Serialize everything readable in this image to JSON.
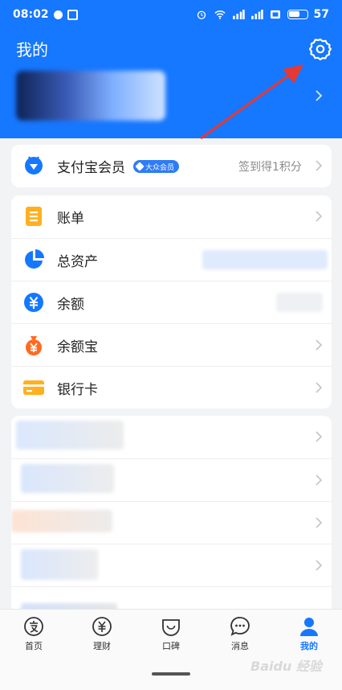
{
  "status_bar": {
    "time": "08:02",
    "battery": "57"
  },
  "header": {
    "title": "我的"
  },
  "member_card": {
    "label": "支付宝会员",
    "badge": "大众会员",
    "action": "签到得1积分"
  },
  "finance_items": [
    {
      "label": "账单",
      "icon": "bill-icon"
    },
    {
      "label": "总资产",
      "icon": "assets-pie-icon"
    },
    {
      "label": "余额",
      "icon": "balance-yuan-icon"
    },
    {
      "label": "余额宝",
      "icon": "yuebao-icon"
    },
    {
      "label": "银行卡",
      "icon": "bank-card-icon"
    }
  ],
  "tabs": [
    {
      "label": "首页",
      "icon": "home-alipay-icon",
      "active": false
    },
    {
      "label": "理财",
      "icon": "finance-yuan-icon",
      "active": false
    },
    {
      "label": "口碑",
      "icon": "koubei-icon",
      "active": false
    },
    {
      "label": "消息",
      "icon": "message-icon",
      "active": false
    },
    {
      "label": "我的",
      "icon": "profile-icon",
      "active": true
    }
  ],
  "watermark": "Baidu 经验",
  "colors": {
    "brand_blue": "#1677ff",
    "annotation_red": "#e53935",
    "bill_orange": "#ffb020",
    "yuebao_orange": "#ff6a21"
  }
}
